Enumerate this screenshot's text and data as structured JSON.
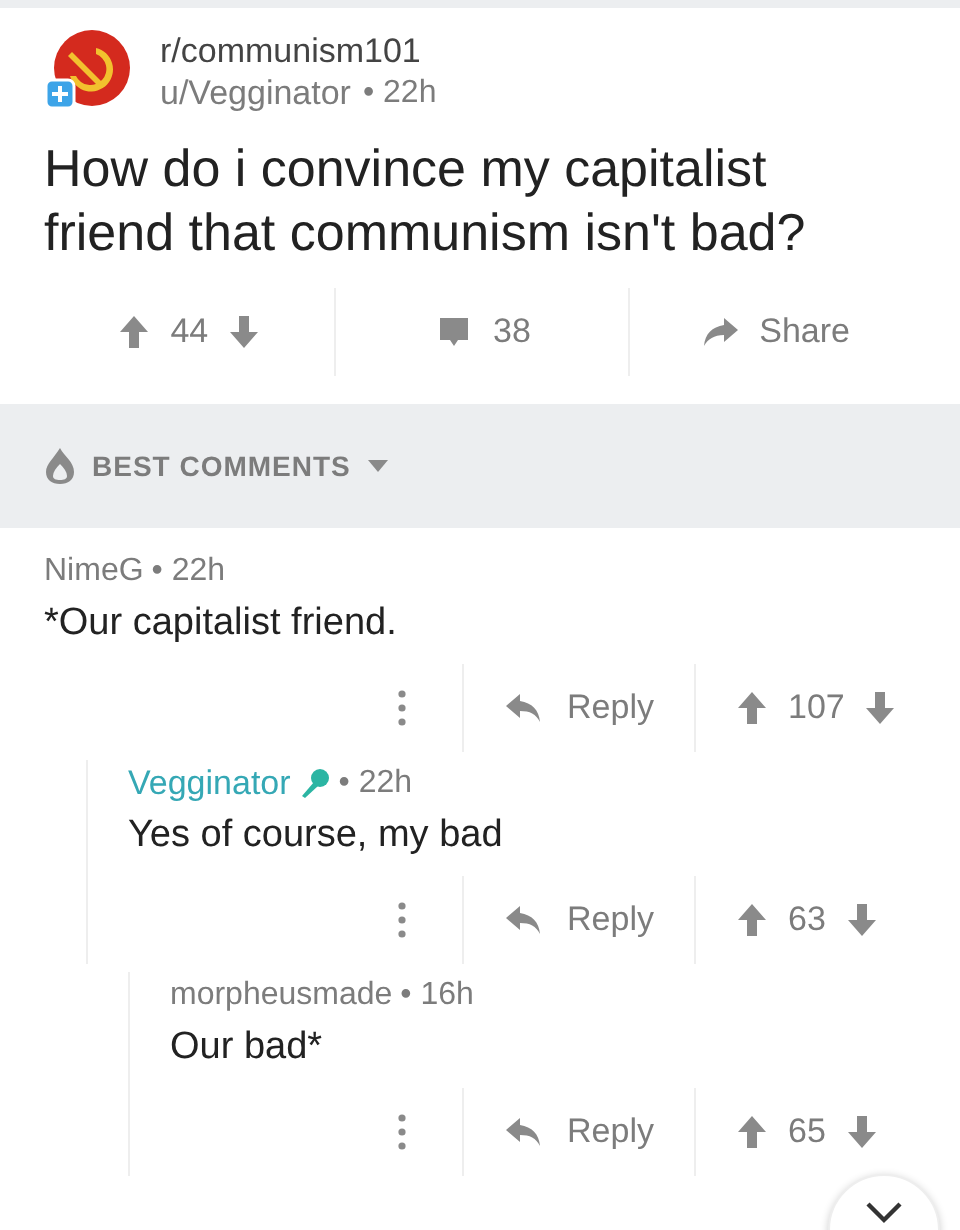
{
  "post": {
    "subreddit": "r/communism101",
    "author": "u/Vegginator",
    "time": "• 22h",
    "title": "How do i convince my capitalist friend that communism isn't bad?",
    "votes": "44",
    "comments": "38",
    "share": "Share"
  },
  "sort": {
    "label": "BEST COMMENTS"
  },
  "comments": [
    {
      "author": "NimeG",
      "op": false,
      "time": "• 22h",
      "body": "*Our capitalist friend.",
      "reply": "Reply",
      "score": "107",
      "children": [
        {
          "author": "Vegginator",
          "op": true,
          "time": "• 22h",
          "body": "Yes of course, my bad",
          "reply": "Reply",
          "score": "63",
          "children": [
            {
              "author": "morpheusmade",
              "op": false,
              "time": "• 16h",
              "body": "Our bad*",
              "reply": "Reply",
              "score": "65"
            }
          ]
        }
      ]
    }
  ]
}
